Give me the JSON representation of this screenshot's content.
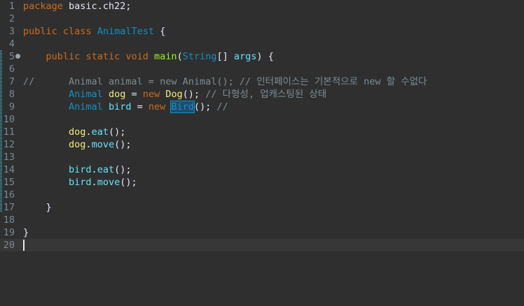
{
  "lines": [
    {
      "num": "1",
      "tokens": [
        [
          "kw",
          "package"
        ],
        [
          "plain",
          " basic.ch22;"
        ]
      ]
    },
    {
      "num": "2",
      "tokens": []
    },
    {
      "num": "3",
      "tokens": [
        [
          "kw",
          "public"
        ],
        [
          "plain",
          " "
        ],
        [
          "kw",
          "class"
        ],
        [
          "plain",
          " "
        ],
        [
          "type",
          "AnimalTest"
        ],
        [
          "plain",
          " {"
        ]
      ]
    },
    {
      "num": "4",
      "tokens": []
    },
    {
      "num": "5",
      "tokens": [
        [
          "plain",
          "    "
        ],
        [
          "kw",
          "public"
        ],
        [
          "plain",
          " "
        ],
        [
          "kw",
          "static"
        ],
        [
          "plain",
          " "
        ],
        [
          "kw",
          "void"
        ],
        [
          "plain",
          " "
        ],
        [
          "method",
          "main"
        ],
        [
          "plain",
          "("
        ],
        [
          "type",
          "String"
        ],
        [
          "plain",
          "[] "
        ],
        [
          "field",
          "args"
        ],
        [
          "plain",
          ") {"
        ]
      ]
    },
    {
      "num": "6",
      "tokens": []
    },
    {
      "num": "7",
      "tokens": [
        [
          "comment",
          "//      Animal animal = new Animal(); // 인터페이스는 기본적으로 new 할 수없다"
        ]
      ]
    },
    {
      "num": "8",
      "tokens": [
        [
          "plain",
          "        "
        ],
        [
          "type",
          "Animal"
        ],
        [
          "plain",
          " "
        ],
        [
          "local",
          "dog"
        ],
        [
          "plain",
          " = "
        ],
        [
          "kw",
          "new"
        ],
        [
          "plain",
          " "
        ],
        [
          "local",
          "Dog"
        ],
        [
          "plain",
          "(); "
        ],
        [
          "comment",
          "// 다형성, 업캐스팅된 상태"
        ]
      ]
    },
    {
      "num": "9",
      "tokens": [
        [
          "plain",
          "        "
        ],
        [
          "type",
          "Animal"
        ],
        [
          "plain",
          " "
        ],
        [
          "field",
          "bird"
        ],
        [
          "plain",
          " = "
        ],
        [
          "kw",
          "new"
        ],
        [
          "plain",
          " "
        ],
        [
          "sel",
          "Bird"
        ],
        [
          "plain",
          "(); "
        ],
        [
          "comment",
          "//"
        ]
      ]
    },
    {
      "num": "10",
      "tokens": []
    },
    {
      "num": "11",
      "tokens": [
        [
          "plain",
          "        "
        ],
        [
          "local",
          "dog"
        ],
        [
          "plain",
          "."
        ],
        [
          "field",
          "eat"
        ],
        [
          "plain",
          "();"
        ]
      ]
    },
    {
      "num": "12",
      "tokens": [
        [
          "plain",
          "        "
        ],
        [
          "local",
          "dog"
        ],
        [
          "plain",
          "."
        ],
        [
          "field",
          "move"
        ],
        [
          "plain",
          "();"
        ]
      ]
    },
    {
      "num": "13",
      "tokens": []
    },
    {
      "num": "14",
      "tokens": [
        [
          "plain",
          "        "
        ],
        [
          "field",
          "bird"
        ],
        [
          "plain",
          "."
        ],
        [
          "field",
          "eat"
        ],
        [
          "plain",
          "();"
        ]
      ]
    },
    {
      "num": "15",
      "tokens": [
        [
          "plain",
          "        "
        ],
        [
          "field",
          "bird"
        ],
        [
          "plain",
          "."
        ],
        [
          "field",
          "move"
        ],
        [
          "plain",
          "();"
        ]
      ]
    },
    {
      "num": "16",
      "tokens": []
    },
    {
      "num": "17",
      "tokens": [
        [
          "plain",
          "    }"
        ]
      ]
    },
    {
      "num": "18",
      "tokens": []
    },
    {
      "num": "19",
      "tokens": [
        [
          "plain",
          "}"
        ]
      ]
    },
    {
      "num": "20",
      "tokens": []
    }
  ],
  "current_line": "20",
  "fold_line": "5",
  "icons": {
    "fold": "collapse-fold-icon"
  }
}
